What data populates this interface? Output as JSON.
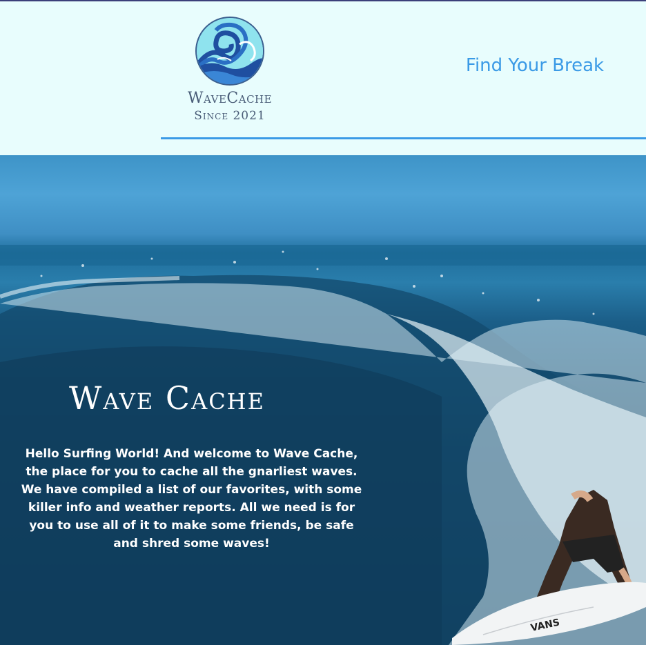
{
  "header": {
    "logo": {
      "name": "WaveCache",
      "since": "Since 2021",
      "icon": "wave-logo-icon"
    },
    "nav": {
      "find_break": "Find Your Break"
    }
  },
  "hero": {
    "title": "Wave Cache",
    "description": "Hello Surfing World! And welcome to Wave Cache, the place for you to cache all the gnarliest waves. We have compiled a list of our favorites, with some killer info and weather reports. All we need is for you to use all of it to make some friends, be safe and shred some waves!",
    "board_brand": "VANS"
  },
  "colors": {
    "header_bg": "#e8fdfd",
    "accent": "#3a9ae6",
    "logo_text": "#4a5d78"
  }
}
